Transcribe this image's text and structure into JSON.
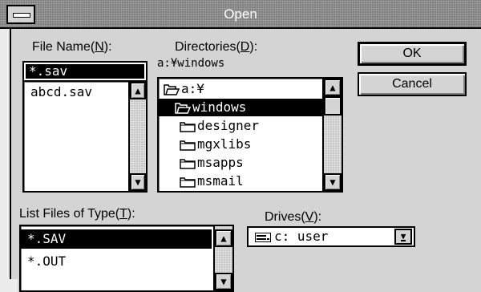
{
  "window": {
    "title": "Open"
  },
  "file_name": {
    "label_pre": "File Name(",
    "label_key": "N",
    "label_post": "):",
    "value": "*.sav",
    "files": [
      "abcd.sav"
    ]
  },
  "directories": {
    "label_pre": "Directories(",
    "label_key": "D",
    "label_post": "):",
    "current_path": "a:¥windows",
    "items": [
      {
        "label": "a:¥",
        "icon": "open-folder-icon",
        "selected": false
      },
      {
        "label": "windows",
        "icon": "open-folder-icon",
        "selected": true
      },
      {
        "label": "designer",
        "icon": "folder-icon",
        "selected": false
      },
      {
        "label": "mgxlibs",
        "icon": "folder-icon",
        "selected": false
      },
      {
        "label": "msapps",
        "icon": "folder-icon",
        "selected": false
      },
      {
        "label": "msmail",
        "icon": "folder-icon",
        "selected": false
      }
    ]
  },
  "buttons": {
    "ok": "OK",
    "cancel": "Cancel"
  },
  "file_type": {
    "label_pre": "List Files of Type(",
    "label_key": "T",
    "label_post": "):",
    "options": [
      "*.SAV",
      "*.OUT"
    ],
    "selected_index": 0
  },
  "drives": {
    "label_pre": "Drives(",
    "label_key": "V",
    "label_post": "):",
    "value": "c: user",
    "icon": "hard-drive-icon"
  },
  "colors": {
    "selection": "#000000",
    "face": "#d4d4d4",
    "title_bar": "#7e7e7e"
  }
}
